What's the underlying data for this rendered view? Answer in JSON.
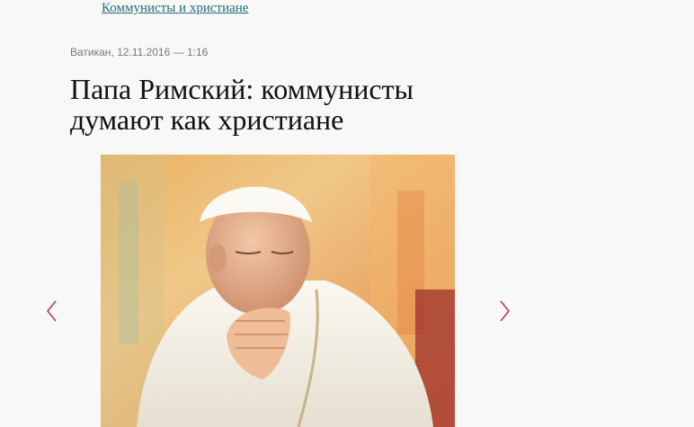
{
  "breadcrumb": {
    "link_text": "Коммунисты и христиане"
  },
  "article": {
    "location": "Ватикан",
    "datetime": "12.11.2016 — 1:16",
    "title": "Папа Римский: коммунисты думают как христиане"
  },
  "gallery": {
    "prev_icon": "chevron-left-icon",
    "next_icon": "chevron-right-icon",
    "arrow_color": "#c0394b"
  },
  "colors": {
    "link": "#1e6e78",
    "meta": "#777777",
    "title": "#111111",
    "background": "#f8f8f8"
  }
}
